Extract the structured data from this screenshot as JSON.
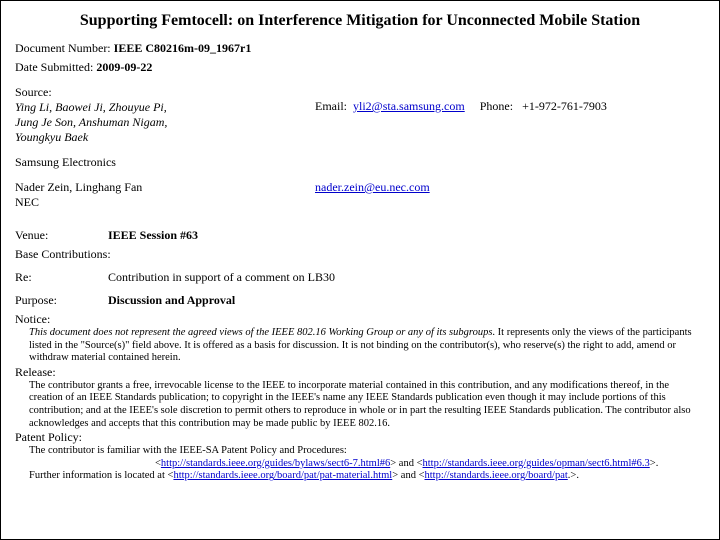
{
  "title": "Supporting Femtocell: on Interference Mitigation for Unconnected Mobile Station",
  "docnum": {
    "label": "Document Number:",
    "value": "IEEE C80216m-09_1967r1"
  },
  "date": {
    "label": "Date Submitted:",
    "value": "2009-09-22"
  },
  "source": {
    "label": "Source:",
    "names_line1": "Ying Li, Baowei Ji, Zhouyue Pi,",
    "names_line2": "Jung Je Son, Anshuman Nigam,",
    "names_line3": "Youngkyu  Baek",
    "email_label": "Email:",
    "email": "yli2@sta.samsung.com",
    "phone_label": "Phone:",
    "phone": "+1-972-761-7903"
  },
  "company1": "Samsung Electronics",
  "source2": {
    "names": "Nader Zein, Linghang Fan",
    "org": "NEC",
    "email": "nader.zein@eu.nec.com"
  },
  "venue": {
    "label": "Venue:",
    "value": "IEEE Session #63"
  },
  "basecon": {
    "label": "Base Contributions:"
  },
  "re": {
    "label": "Re:",
    "value": "Contribution in support of a comment on LB30"
  },
  "purpose": {
    "label": "Purpose:",
    "value": "Discussion and Approval"
  },
  "notice": {
    "label": "Notice:",
    "text_prefix": "This document does not represent the agreed views of the IEEE 802.16 Working Group or any of its subgroups",
    "text_suffix": ". It represents only the views of the participants listed in the \"Source(s)\" field above. It is offered as a basis for discussion. It is not binding on the contributor(s), who reserve(s) the right to add, amend or withdraw material contained herein."
  },
  "release": {
    "label": "Release:",
    "text": "The contributor grants a free, irrevocable license to the IEEE to incorporate material contained in this contribution, and any modifications thereof, in the creation of an IEEE Standards publication; to copyright in the IEEE's name any IEEE Standards publication even though it may include portions of this contribution; and at the IEEE's sole discretion to permit others to reproduce in whole or in part the resulting IEEE Standards publication. The contributor also acknowledges and accepts that this contribution may be made public by IEEE 802.16."
  },
  "patent": {
    "label": "Patent Policy:",
    "line1": "The contributor is familiar with the IEEE-SA Patent Policy and Procedures:",
    "link1": "http://standards.ieee.org/guides/bylaws/sect6-7.html#6",
    "and": " and ",
    "link2": "http://standards.ieee.org/guides/opman/sect6.html#6.3",
    "line2_prefix": "Further information is located at ",
    "link3": "http://standards.ieee.org/board/pat/pat-material.html",
    "link4": "http://standards.ieee.org/board/pat",
    "angle_open": "<",
    "angle_close": ">",
    "period": "."
  }
}
